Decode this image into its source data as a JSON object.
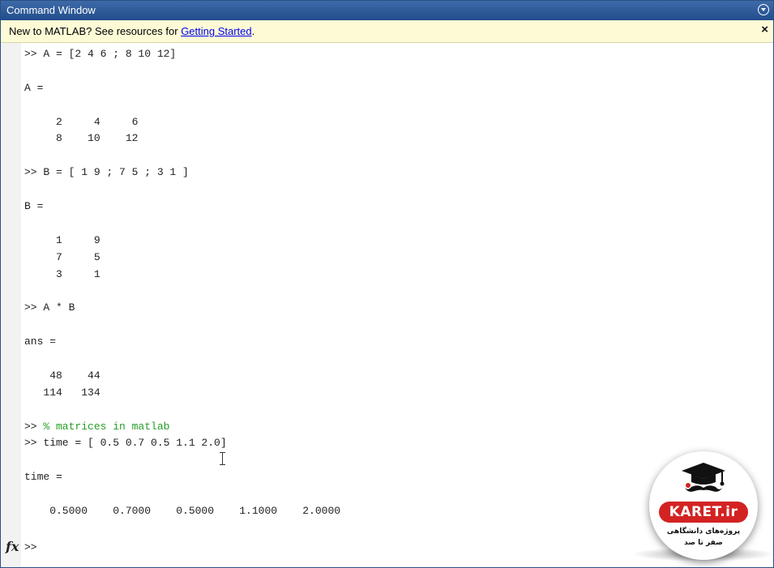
{
  "window": {
    "title": "Command Window"
  },
  "infobar": {
    "message_prefix": "New to MATLAB? See resources for ",
    "link_text": "Getting Started",
    "message_suffix": ".",
    "close_glyph": "×"
  },
  "console": {
    "lines": [
      {
        "text": ">> A = [2 4 6 ; 8 10 12]",
        "type": "command"
      },
      {
        "text": "",
        "type": "blank"
      },
      {
        "text": "A =",
        "type": "output"
      },
      {
        "text": "",
        "type": "blank"
      },
      {
        "text": "     2     4     6",
        "type": "output"
      },
      {
        "text": "     8    10    12",
        "type": "output"
      },
      {
        "text": "",
        "type": "blank"
      },
      {
        "text": ">> B = [ 1 9 ; 7 5 ; 3 1 ]",
        "type": "command"
      },
      {
        "text": "",
        "type": "blank"
      },
      {
        "text": "B =",
        "type": "output"
      },
      {
        "text": "",
        "type": "blank"
      },
      {
        "text": "     1     9",
        "type": "output"
      },
      {
        "text": "     7     5",
        "type": "output"
      },
      {
        "text": "     3     1",
        "type": "output"
      },
      {
        "text": "",
        "type": "blank"
      },
      {
        "text": ">> A * B",
        "type": "command"
      },
      {
        "text": "",
        "type": "blank"
      },
      {
        "text": "ans =",
        "type": "output"
      },
      {
        "text": "",
        "type": "blank"
      },
      {
        "text": "    48    44",
        "type": "output"
      },
      {
        "text": "   114   134",
        "type": "output"
      },
      {
        "text": "",
        "type": "blank"
      },
      {
        "text": ">> % matrices in matlab",
        "type": "comment"
      },
      {
        "text": ">> time = [ 0.5 0.7 0.5 1.1 2.0]",
        "type": "command"
      },
      {
        "text": "",
        "type": "blank"
      },
      {
        "text": "time =",
        "type": "output"
      },
      {
        "text": "",
        "type": "blank"
      },
      {
        "text": "    0.5000    0.7000    0.5000    1.1000    2.0000",
        "type": "output"
      }
    ]
  },
  "prompt": {
    "fx_label": "fx",
    "symbol": ">>"
  },
  "watermark": {
    "brand": "KARET.ir",
    "tagline_line1": "پروژه‌های دانشگاهی",
    "tagline_line2": "صفر تا صد",
    "icon": "graduation-cap-mustache-icon"
  },
  "colors": {
    "titlebar": "#2f5b99",
    "infobar_bg": "#fdfbd6",
    "comment": "#259e24",
    "link": "#0000ee",
    "logo_red": "#d32222"
  }
}
